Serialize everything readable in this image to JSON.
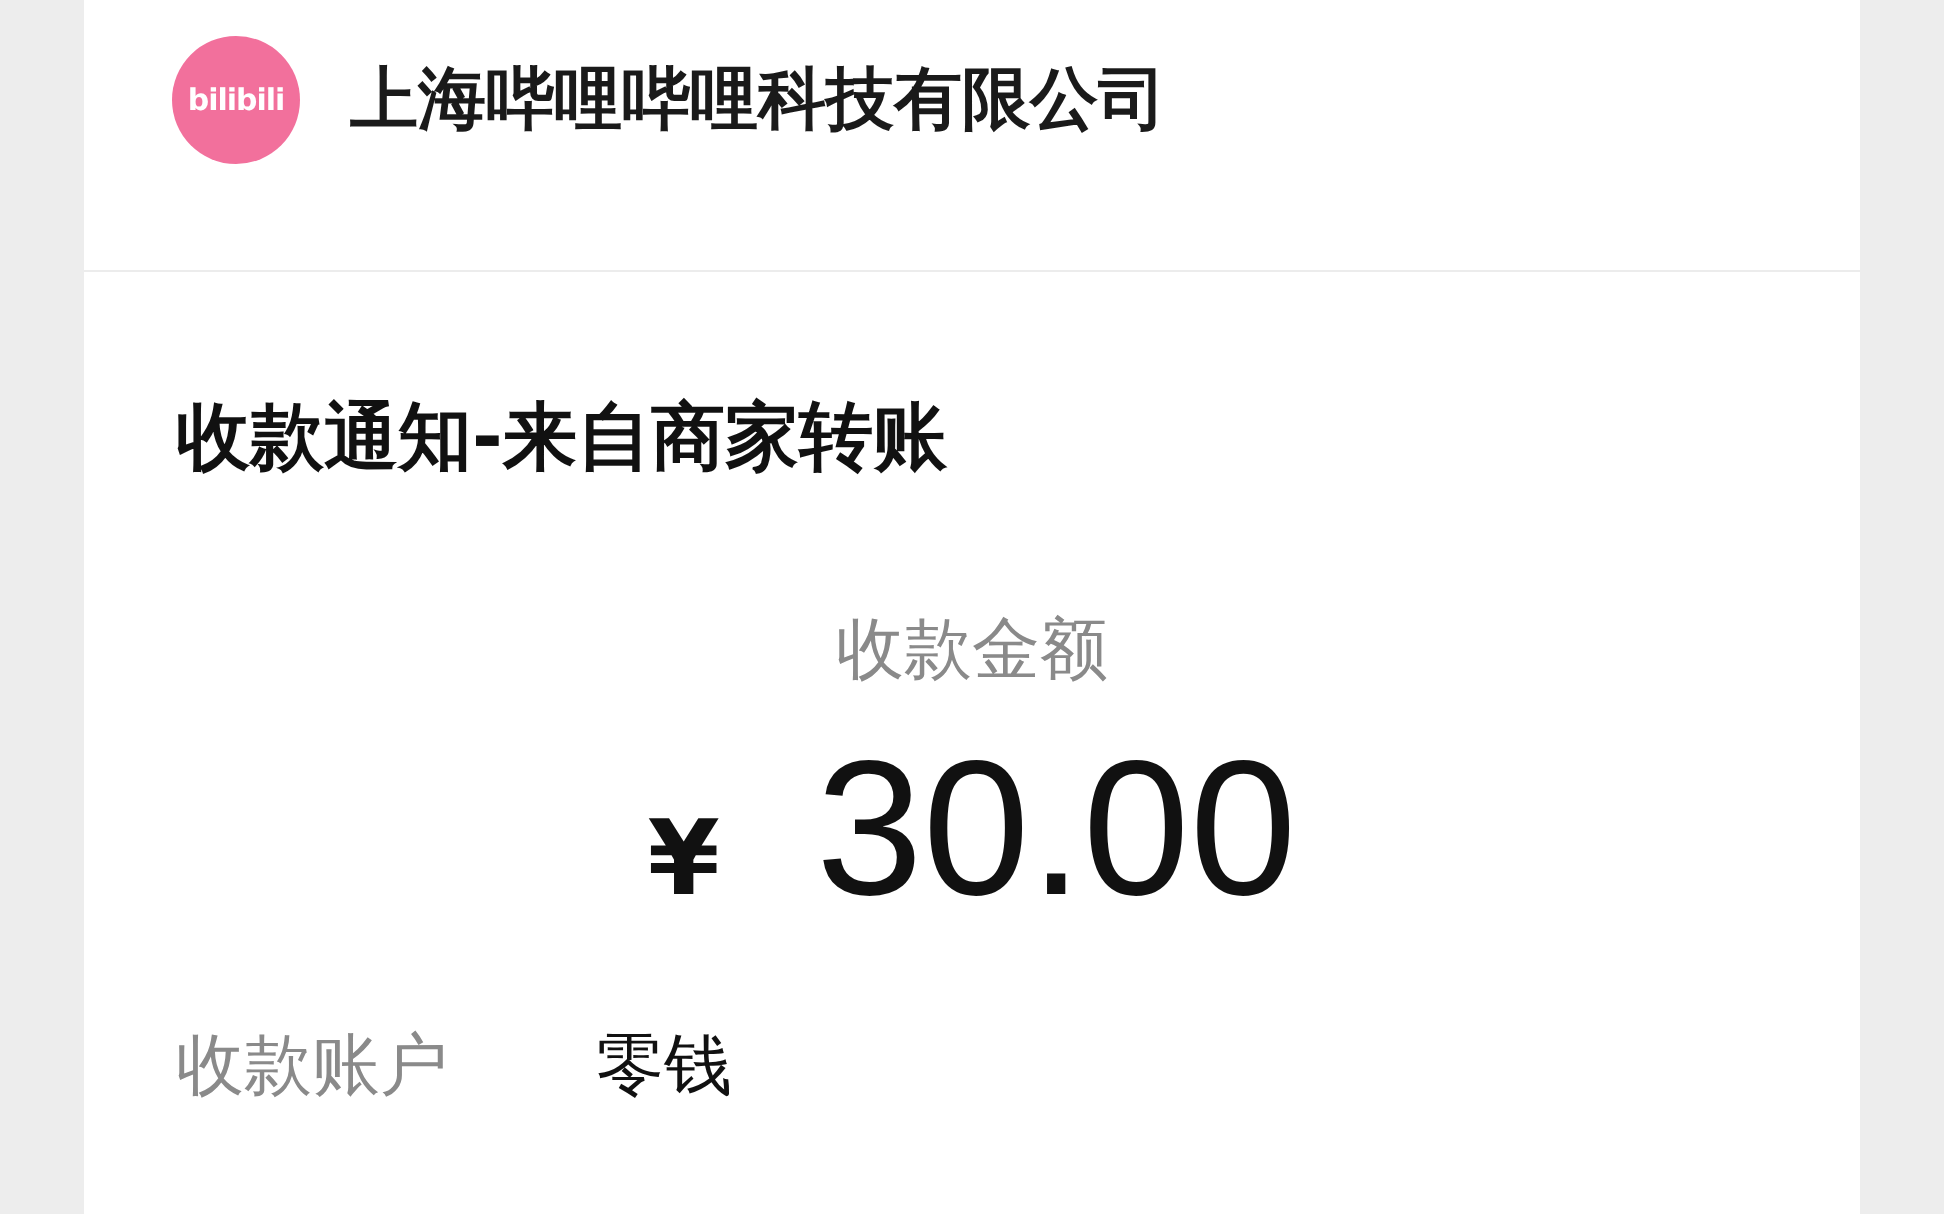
{
  "merchant": {
    "logo_text": "bilibili",
    "name": "上海哔哩哔哩科技有限公司"
  },
  "notice": {
    "title": "收款通知-来自商家转账",
    "amount_label": "收款金额",
    "currency": "¥",
    "amount": "30.00",
    "fields": [
      {
        "label": "收款账户",
        "value": "零钱"
      }
    ]
  }
}
